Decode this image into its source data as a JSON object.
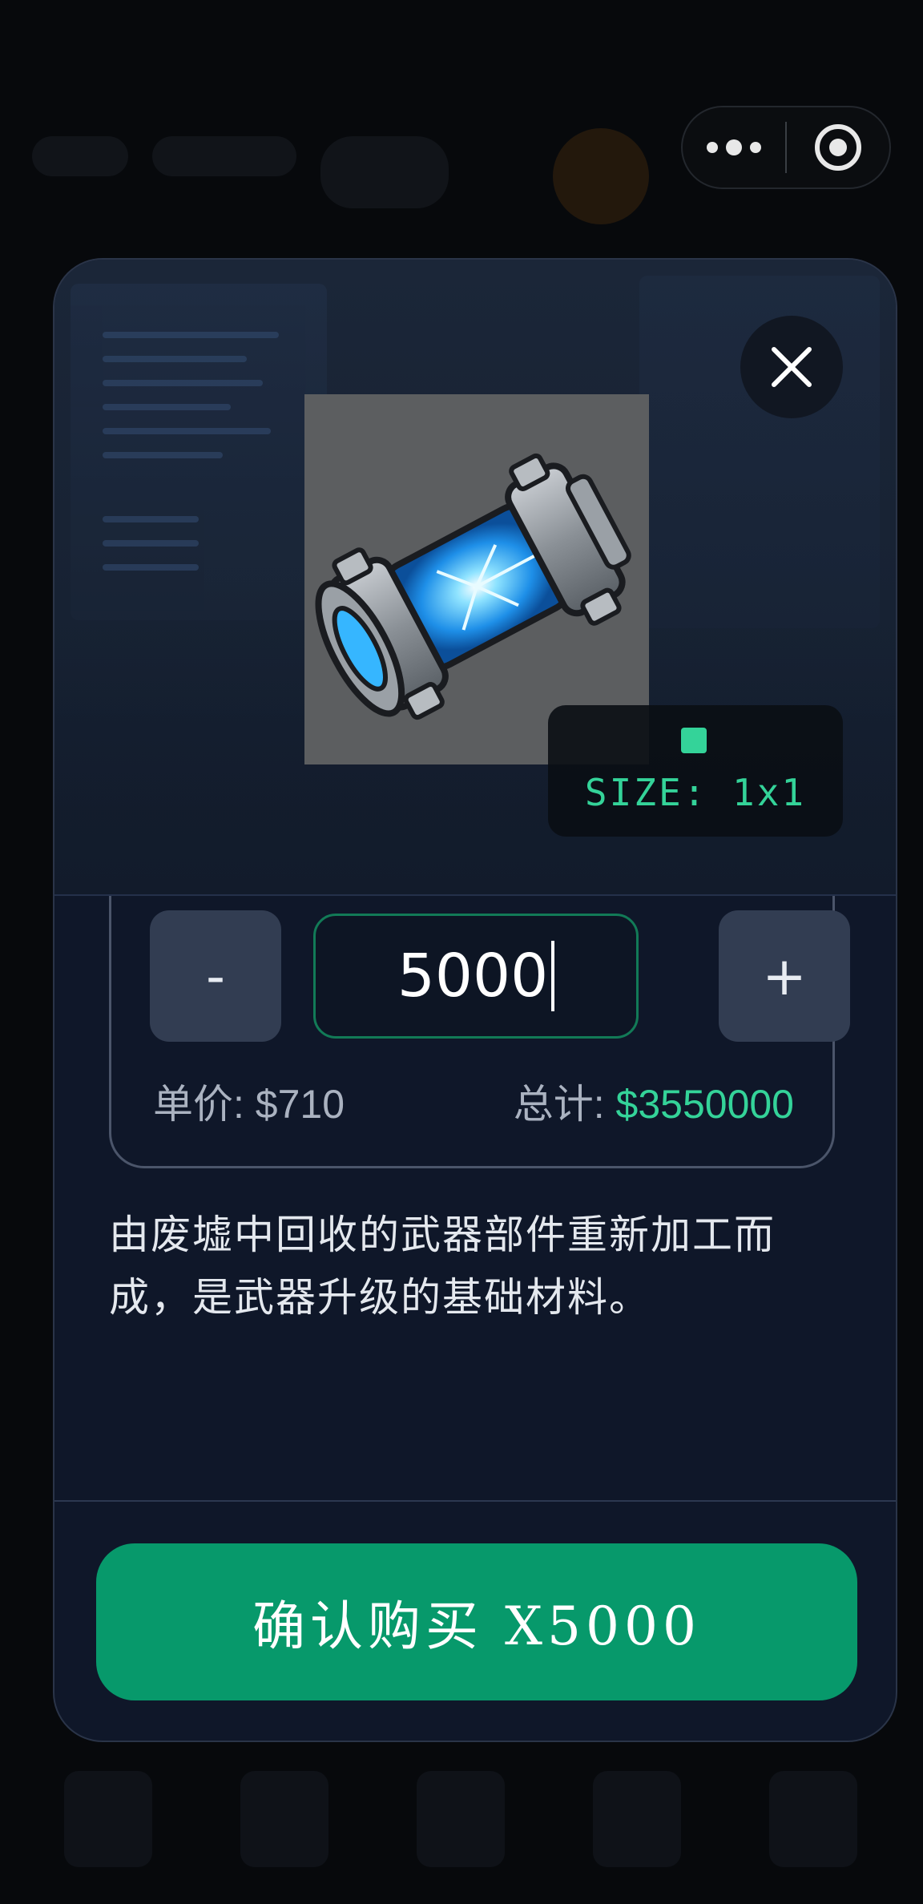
{
  "item": {
    "size_label": "SIZE: 1x1",
    "image_icon": "energy-cell-icon",
    "description": "由废墟中回收的武器部件重新加工而成，是武器升级的基础材料。"
  },
  "quantity": {
    "decrement_label": "-",
    "increment_label": "+",
    "value": "5000"
  },
  "pricing": {
    "unit_label": "单价: ",
    "unit_value": "$710",
    "total_label": "总计: ",
    "total_value": "$3550000"
  },
  "actions": {
    "confirm_label": "确认购买 X5000",
    "close_icon": "close-icon"
  },
  "colors": {
    "accent": "#34d399",
    "confirm_bg": "#07996b",
    "modal_bg": "#0f1729"
  }
}
